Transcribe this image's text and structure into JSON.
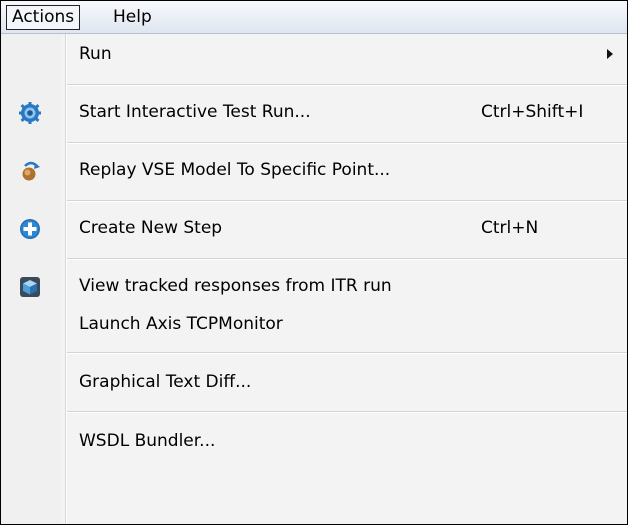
{
  "menubar": {
    "actions_label": "Actions",
    "help_label": "Help"
  },
  "menu": {
    "items": [
      {
        "label": "Run",
        "shortcut": "",
        "submenu": true,
        "icon": ""
      },
      {
        "label": "Start Interactive Test Run...",
        "shortcut": "Ctrl+Shift+I",
        "icon": "gear-icon"
      },
      {
        "label": "Replay VSE Model To Specific Point...",
        "shortcut": "",
        "icon": "replay-icon"
      },
      {
        "label": "Create New Step",
        "shortcut": "Ctrl+N",
        "icon": "plus-circle-icon"
      },
      {
        "label": "View tracked responses from ITR run",
        "shortcut": "",
        "icon": "cube-icon"
      },
      {
        "label": "Launch Axis TCPMonitor",
        "shortcut": "",
        "icon": ""
      },
      {
        "label": "Graphical Text Diff...",
        "shortcut": "",
        "icon": ""
      },
      {
        "label": "WSDL Bundler...",
        "shortcut": "",
        "icon": ""
      }
    ]
  },
  "colors": {
    "menubar_gradient_top": "#f7f9fc",
    "menubar_gradient_bottom": "#dfe6f0",
    "menu_background": "#f3f3f3",
    "icon_blue": "#1f6fb8"
  }
}
